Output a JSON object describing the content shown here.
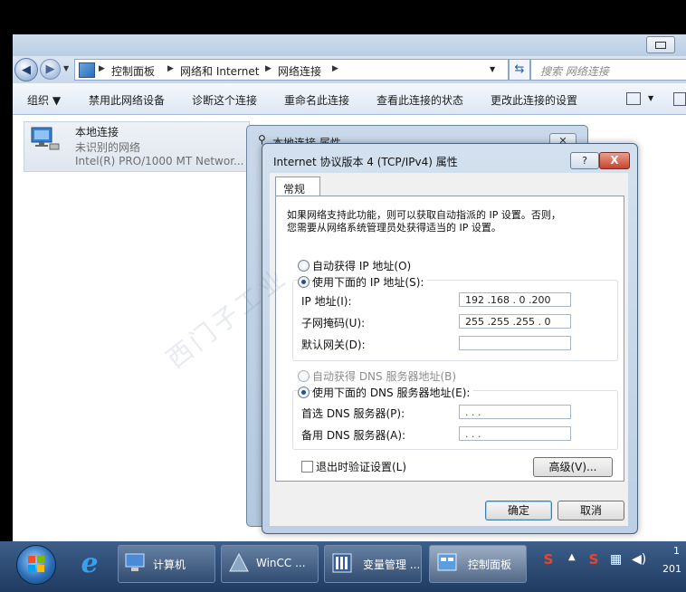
{
  "address_bar": {
    "crumbs": [
      "控制面板",
      "网络和 Internet",
      "网络连接"
    ],
    "search_placeholder": "搜索 网络连接"
  },
  "toolbar": {
    "organize": "组织 ▼",
    "disable": "禁用此网络设备",
    "diagnose": "诊断这个连接",
    "rename": "重命名此连接",
    "status": "查看此连接的状态",
    "change": "更改此连接的设置"
  },
  "connection": {
    "name": "本地连接",
    "status": "未识别的网络",
    "adapter": "Intel(R) PRO/1000 MT Networ..."
  },
  "back_dialog": {
    "title": "本地连接 属性"
  },
  "dialog": {
    "title": "Internet 协议版本 4 (TCP/IPv4) 属性",
    "help": "?",
    "close": "X",
    "tab": "常规",
    "desc_line1": "如果网络支持此功能，则可以获取自动指派的 IP 设置。否则，",
    "desc_line2": "您需要从网络系统管理员处获得适当的 IP 设置。",
    "auto_ip": "自动获得 IP 地址(O)",
    "manual_ip": "使用下面的 IP 地址(S):",
    "ip_label": "IP 地址(I):",
    "ip_value": "192 .168 . 0 .200",
    "mask_label": "子网掩码(U):",
    "mask_value": "255 .255 .255 . 0",
    "gateway_label": "默认网关(D):",
    "gateway_value": "",
    "auto_dns": "自动获得 DNS 服务器地址(B)",
    "manual_dns": "使用下面的 DNS 服务器地址(E):",
    "dns1_label": "首选 DNS 服务器(P):",
    "dns1_value": ".      .      .",
    "dns2_label": "备用 DNS 服务器(A):",
    "dns2_value": ".      .      .",
    "validate": "退出时验证设置(L)",
    "advanced": "高级(V)...",
    "ok": "确定",
    "cancel": "取消"
  },
  "taskbar": {
    "tasks": [
      {
        "label": "计算机"
      },
      {
        "label": "WinCC ..."
      },
      {
        "label": "变量管理 ..."
      },
      {
        "label": "控制面板"
      }
    ],
    "clock_line1": "1",
    "clock_line2": "201"
  }
}
